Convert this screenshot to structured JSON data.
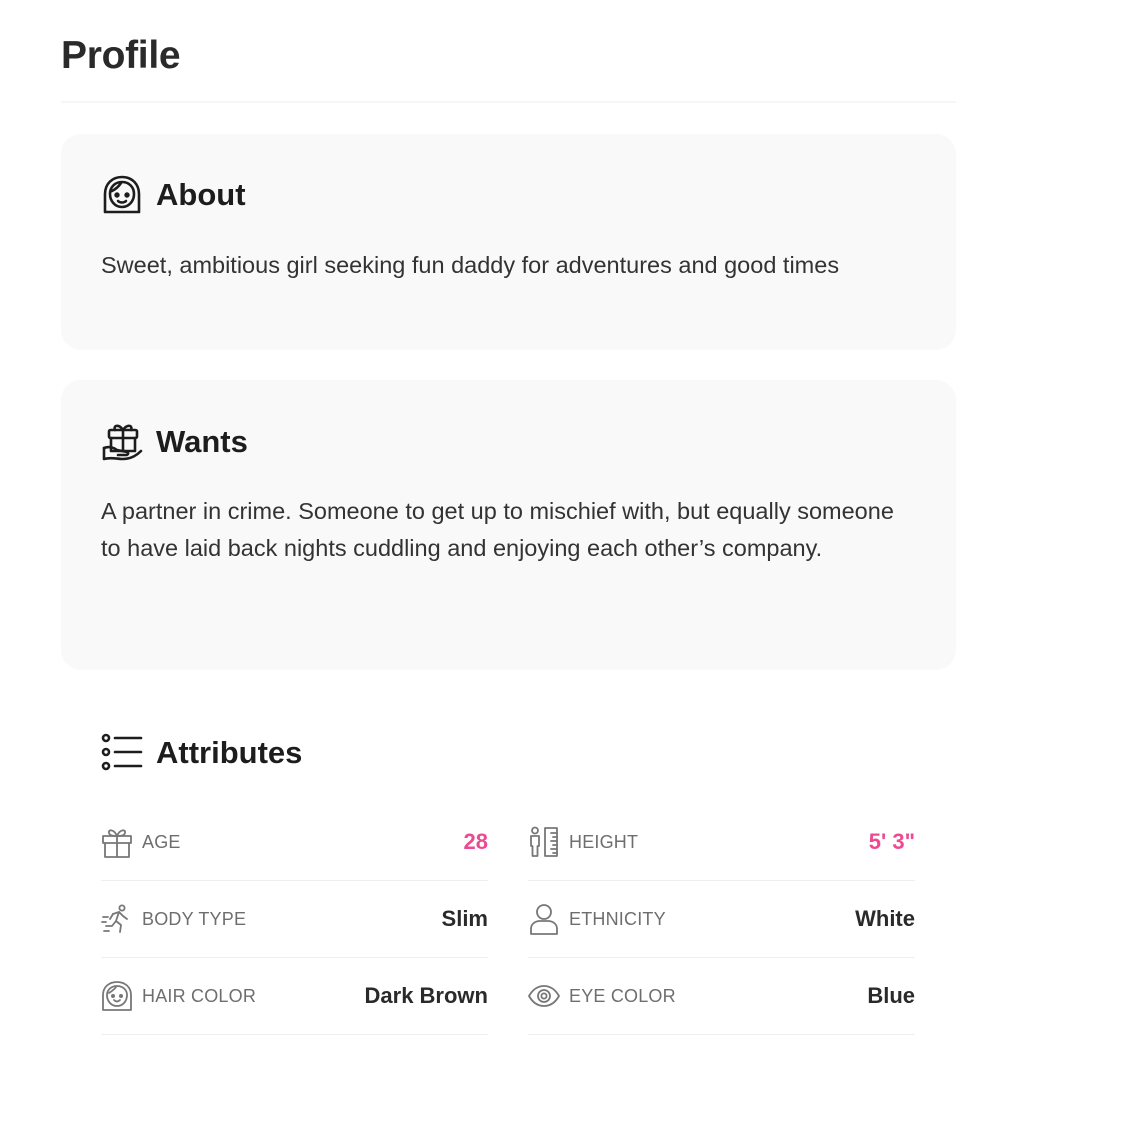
{
  "page": {
    "title": "Profile"
  },
  "about": {
    "title": "About",
    "icon": "face-icon",
    "text": "Sweet, ambitious girl seeking fun daddy for adventures and good times"
  },
  "wants": {
    "title": "Wants",
    "icon": "gift-box-icon",
    "text": "A partner in crime. Someone to get up to mischief with, but equally someone to have laid back nights cuddling and enjoying each other’s company."
  },
  "attributes": {
    "title": "Attributes",
    "icon": "list-icon",
    "accent_color": "#ec4a92",
    "items": [
      {
        "label": "AGE",
        "value": "28",
        "icon": "gift-icon"
      },
      {
        "label": "HEIGHT",
        "value": "5' 3\"",
        "icon": "height-ruler-icon"
      },
      {
        "label": "BODY TYPE",
        "value": "Slim",
        "icon": "running-person-icon"
      },
      {
        "label": "ETHNICITY",
        "value": "White",
        "icon": "person-icon"
      },
      {
        "label": "HAIR COLOR",
        "value": "Dark Brown",
        "icon": "face-hair-icon"
      },
      {
        "label": "EYE COLOR",
        "value": "Blue",
        "icon": "eye-icon"
      }
    ]
  }
}
